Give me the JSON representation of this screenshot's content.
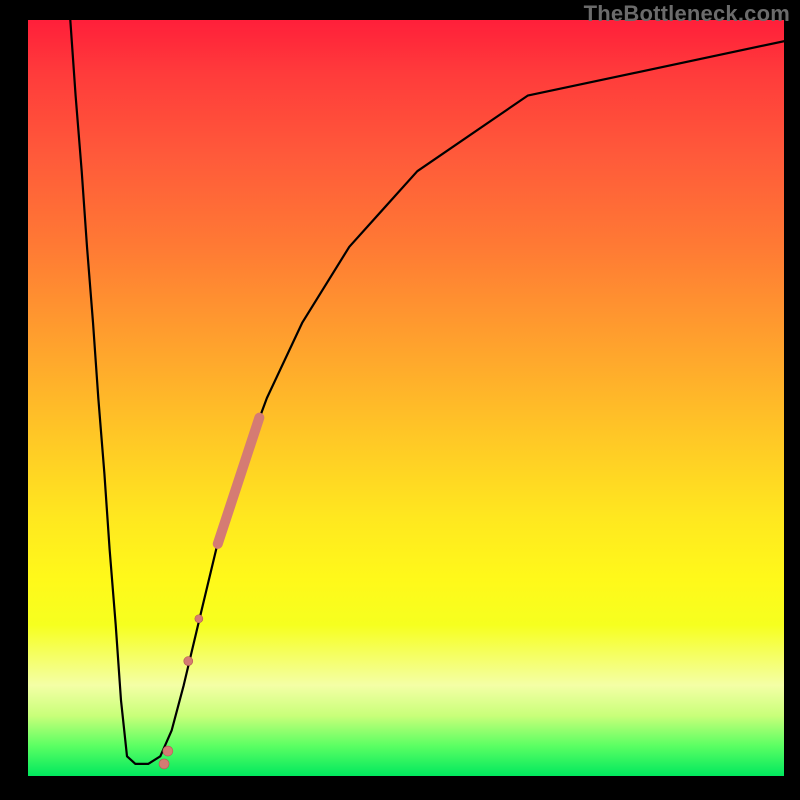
{
  "watermark": "TheBottleneck.com",
  "colors": {
    "background": "#000000",
    "curve": "#000000",
    "beads_fill": "#d57b73",
    "beads_stroke": "#b45a55"
  },
  "chart_data": {
    "type": "line",
    "title": "",
    "xlabel": "",
    "ylabel": "",
    "xlim": [
      0,
      100
    ],
    "ylim": [
      0,
      100
    ],
    "grid": false,
    "curve": [
      {
        "x": 5.6,
        "y": 100
      },
      {
        "x": 6.3,
        "y": 90
      },
      {
        "x": 7.1,
        "y": 80
      },
      {
        "x": 7.8,
        "y": 70
      },
      {
        "x": 8.6,
        "y": 60
      },
      {
        "x": 9.3,
        "y": 50
      },
      {
        "x": 10.1,
        "y": 40
      },
      {
        "x": 10.8,
        "y": 30
      },
      {
        "x": 11.6,
        "y": 20
      },
      {
        "x": 12.3,
        "y": 10
      },
      {
        "x": 13.1,
        "y": 2.6
      },
      {
        "x": 14.2,
        "y": 1.6
      },
      {
        "x": 15.9,
        "y": 1.6
      },
      {
        "x": 17.5,
        "y": 2.6
      },
      {
        "x": 19.0,
        "y": 6
      },
      {
        "x": 20.6,
        "y": 12
      },
      {
        "x": 22.5,
        "y": 20
      },
      {
        "x": 24.9,
        "y": 30
      },
      {
        "x": 27.9,
        "y": 40
      },
      {
        "x": 31.6,
        "y": 50
      },
      {
        "x": 36.3,
        "y": 60
      },
      {
        "x": 42.5,
        "y": 70
      },
      {
        "x": 51.5,
        "y": 80
      },
      {
        "x": 66.1,
        "y": 90
      },
      {
        "x": 100,
        "y": 97.2
      }
    ],
    "beads": {
      "segment_start": {
        "x": 25.1,
        "y": 30.7
      },
      "segment_end_approx": {
        "x": 30.6,
        "y": 47.4
      },
      "segment_width": 10,
      "extra_points": [
        {
          "x": 22.6,
          "y": 20.8,
          "r": 4
        },
        {
          "x": 21.2,
          "y": 15.2,
          "r": 4.5
        },
        {
          "x": 18.5,
          "y": 3.3,
          "r": 5
        },
        {
          "x": 18.0,
          "y": 1.6,
          "r": 5
        }
      ]
    }
  }
}
